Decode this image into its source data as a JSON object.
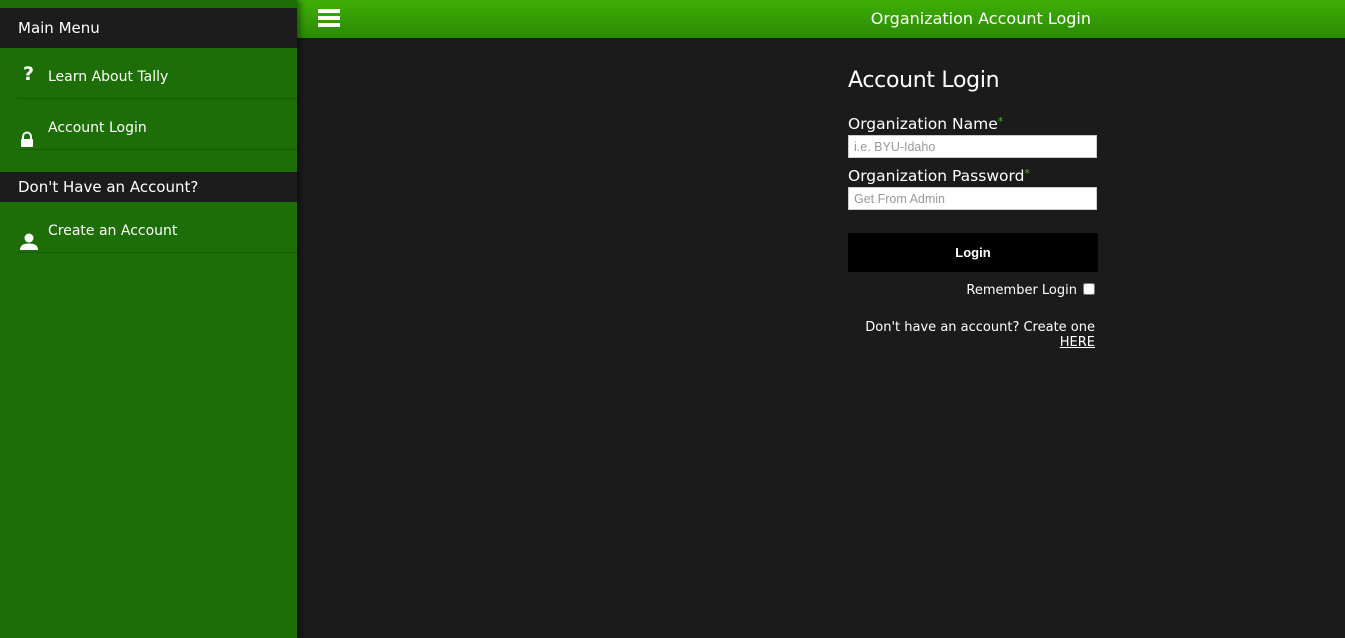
{
  "sidebar": {
    "main_menu_title": "Main Menu",
    "items": [
      {
        "label": "Learn About Tally",
        "icon": "question-icon"
      },
      {
        "label": "Account Login",
        "icon": "lock-icon"
      }
    ],
    "no_account_title": "Don't Have an Account?",
    "extra_items": [
      {
        "label": "Create an Account",
        "icon": "user-icon"
      }
    ]
  },
  "topbar": {
    "title": "Organization Account Login"
  },
  "login": {
    "heading": "Account Login",
    "org_name_label": "Organization Name",
    "org_name_placeholder": "i.e. BYU-Idaho",
    "org_password_label": "Organization Password",
    "org_password_placeholder": "Get From Admin",
    "required_marker": "*",
    "button_label": "Login",
    "remember_label": "Remember Login",
    "signup_text": "Don't have an account? Create one",
    "signup_link": "HERE"
  },
  "colors": {
    "sidebar_green": "#1e6e08",
    "topbar_green": "#3fb005",
    "background": "#1b1b1b",
    "required_green": "#3ec01a"
  }
}
